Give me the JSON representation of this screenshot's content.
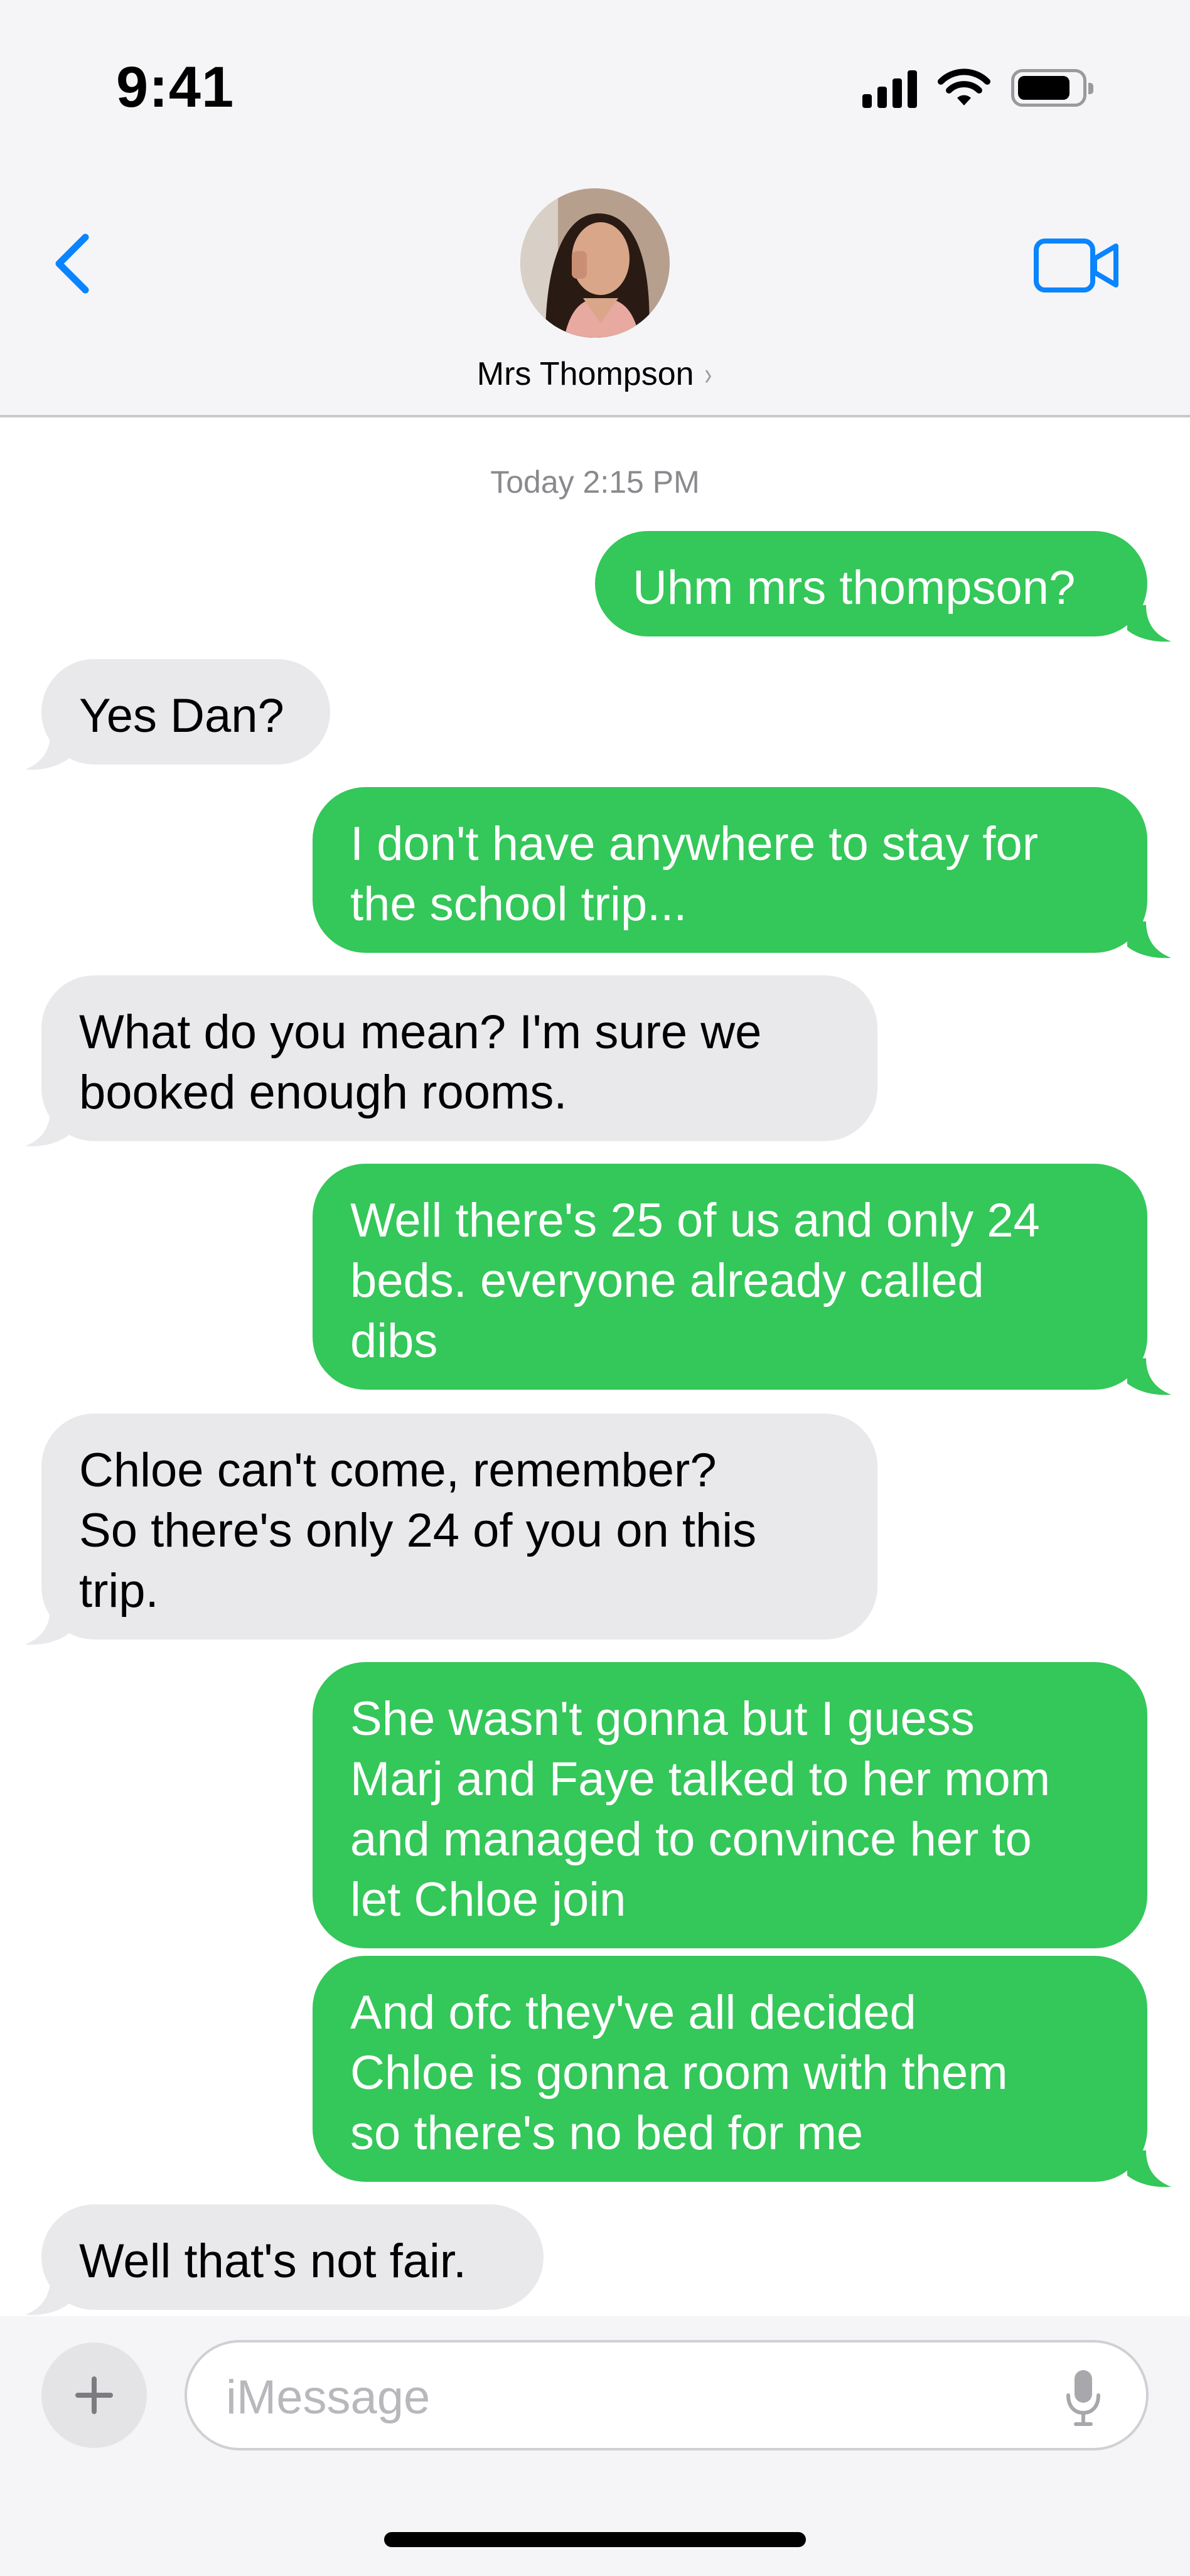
{
  "status_bar": {
    "time": "9:41",
    "icons": [
      "signal-icon",
      "wifi-icon",
      "battery-icon"
    ]
  },
  "nav": {
    "back_icon": "chevron-left-icon",
    "video_icon": "video-camera-icon",
    "accent_color": "#0a84ff"
  },
  "contact": {
    "name": "Mrs Thompson",
    "avatar": "contact-photo"
  },
  "conversation": {
    "timestamp": "Today 2:15 PM",
    "sent_color": "#34c759",
    "received_color": "#e9e9eb",
    "messages": [
      {
        "from": "me",
        "text": "Uhm mrs thompson?"
      },
      {
        "from": "them",
        "text": "Yes Dan?"
      },
      {
        "from": "me",
        "text": "I don't have anywhere to stay for\nthe school trip..."
      },
      {
        "from": "them",
        "text": "What do you mean? I'm sure we\nbooked enough rooms."
      },
      {
        "from": "me",
        "text": "Well there's 25 of us and only 24\nbeds. everyone already called\ndibs"
      },
      {
        "from": "them",
        "text": "Chloe can't come, remember?\nSo there's only 24 of you on this\ntrip."
      },
      {
        "from": "me",
        "text": "She wasn't gonna but I guess\nMarj and Faye talked to her mom\nand managed to convince her to\nlet Chloe join"
      },
      {
        "from": "me",
        "text": "And ofc they've all decided\nChloe is gonna room with them\nso there's no bed for me"
      },
      {
        "from": "them",
        "text": "Well that's not fair."
      }
    ]
  },
  "input": {
    "plus_icon": "plus-icon",
    "placeholder": "iMessage",
    "mic_icon": "microphone-icon"
  }
}
